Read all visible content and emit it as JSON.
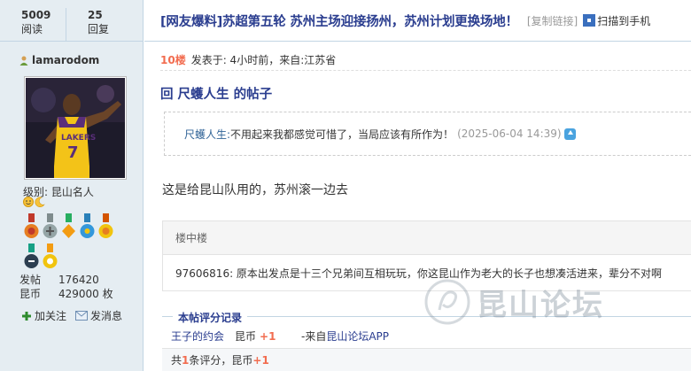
{
  "stats": {
    "reads_value": "5009",
    "reads_label": "阅读",
    "replies_value": "25",
    "replies_label": "回复"
  },
  "user": {
    "name": "lamarodom",
    "level_label": "级别: 昆山名人",
    "posts_label": "发帖",
    "posts_value": "176420",
    "coins_label": "昆币",
    "coins_value": "429000 枚",
    "follow_label": "加关注",
    "message_label": "发消息"
  },
  "thread": {
    "title": "[网友爆料]苏超第五轮 苏州主场迎接扬州，苏州计划更换场地！",
    "copy_link": "[复制链接]",
    "scan_to_phone": "扫描到手机"
  },
  "post": {
    "floor": "10楼",
    "meta": "发表于: 4小时前，来自:江苏省",
    "reply_heading": "回 尺蠖人生 的帖子",
    "quote_author": "尺蠖人生:",
    "quote_text": "不用起来我都感觉可惜了，当局应该有所作为！",
    "quote_time": "(2025-06-04 14:39)",
    "body": "这是给昆山队用的，苏州滚一边去",
    "inner_header": "楼中楼",
    "inner_reply": "97606816: 原本出发点是十三个兄弟间互相玩玩，你这昆山作为老大的长子也想凑活进来，辈分不对啊"
  },
  "rating": {
    "legend": "本帖评分记录",
    "rater": "王子的约会",
    "coin_label": "昆币",
    "coin_amount": "+1",
    "source_prefix": "-来自",
    "source_app": "昆山论坛APP",
    "summary_prefix": "共",
    "summary_count": "1",
    "summary_mid": "条评分，昆币",
    "summary_amount": "+1"
  },
  "watermark": {
    "text": "昆山论坛"
  },
  "colors": {
    "title_blue": "#2a3d8f",
    "accent_orange": "#f26c4f",
    "sidebar_bg": "#e5edf2"
  }
}
